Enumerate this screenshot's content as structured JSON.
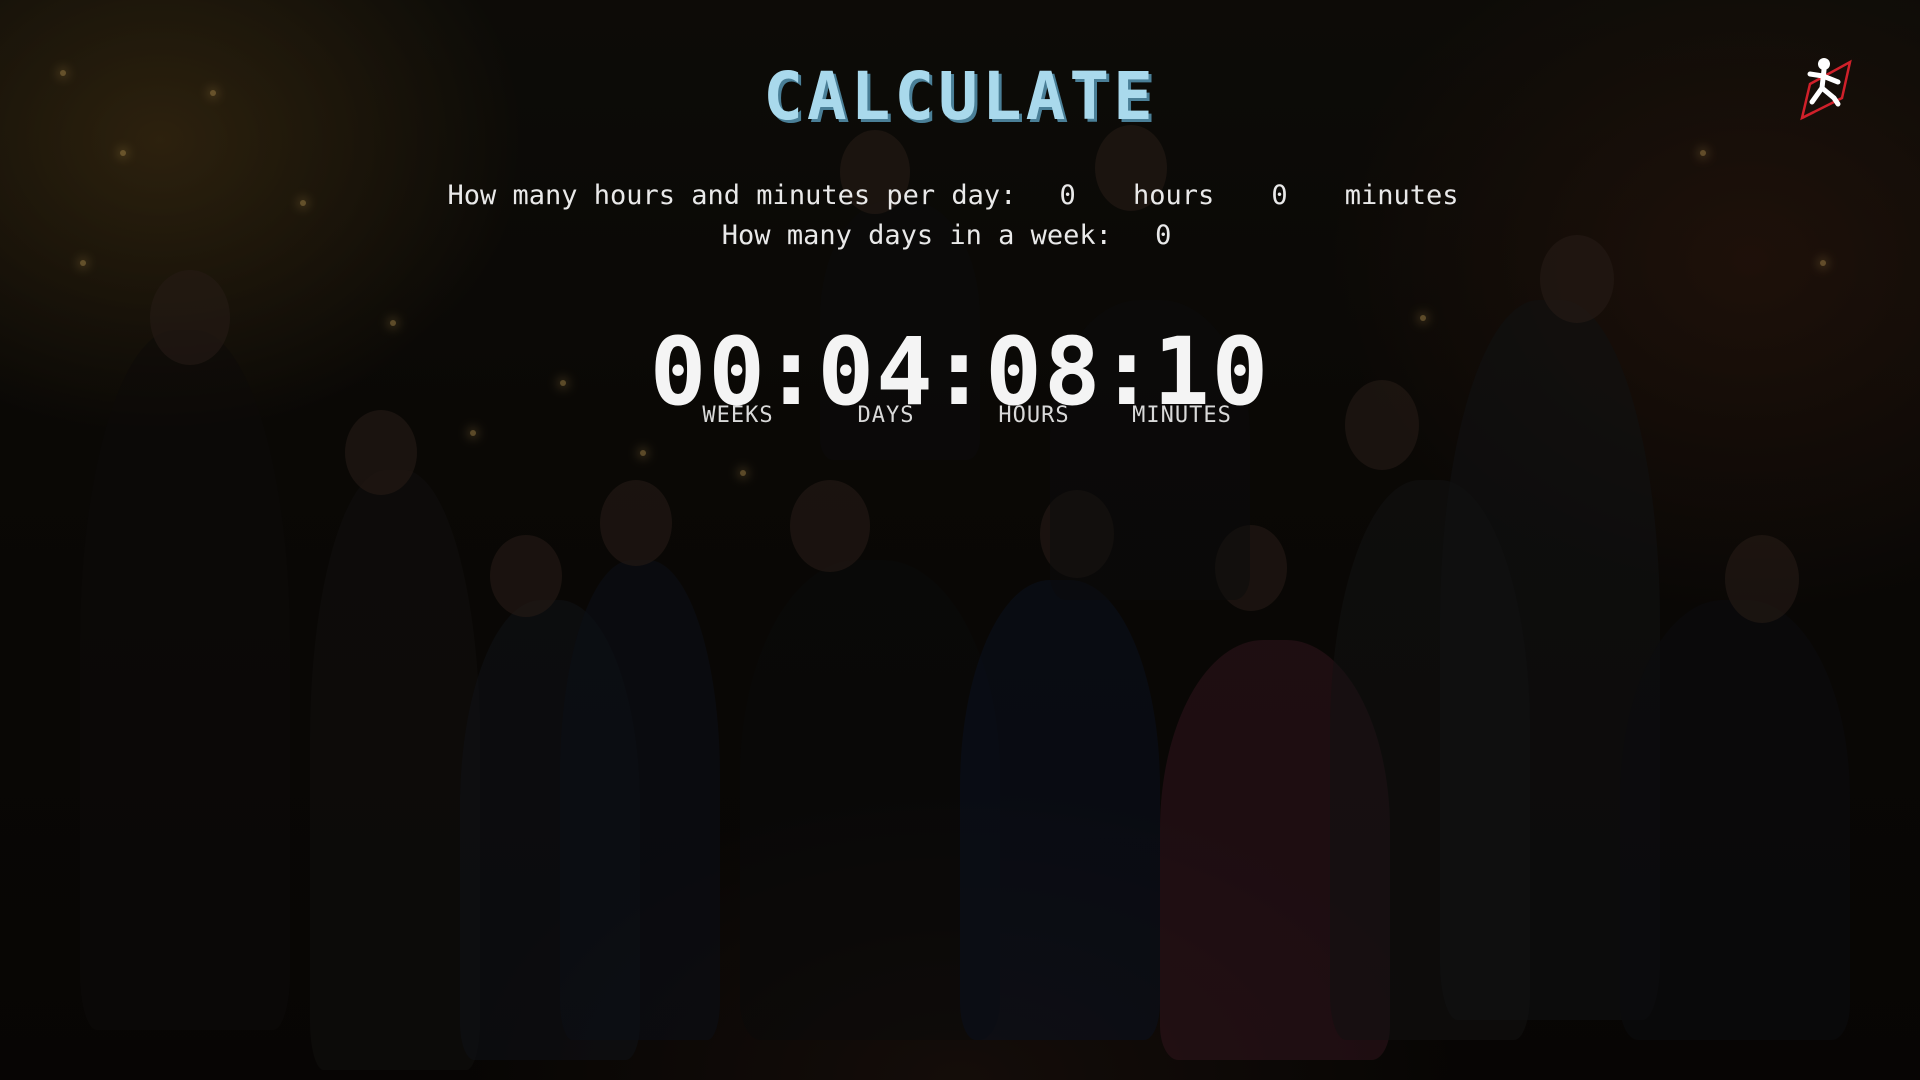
{
  "title": "CALCULATE",
  "questions": {
    "per_day_label": "How many hours and minutes per day:",
    "hours_value": "0",
    "hours_unit": "hours",
    "minutes_value": "0",
    "minutes_unit": "minutes",
    "days_label": "How many days in a week:",
    "days_value": "0"
  },
  "timer": {
    "weeks": "00",
    "days": "04",
    "hours": "08",
    "minutes": "10",
    "separator": ":"
  },
  "timer_labels": {
    "weeks": "WEEKS",
    "days": "DAYS",
    "hours": "HOURS",
    "minutes": "MINUTES"
  },
  "logo": {
    "icon": "running-figure-logo-icon"
  },
  "colors": {
    "title": "#a9d9ec",
    "text": "#e9e9e9",
    "logo_accent": "#d0202a"
  }
}
